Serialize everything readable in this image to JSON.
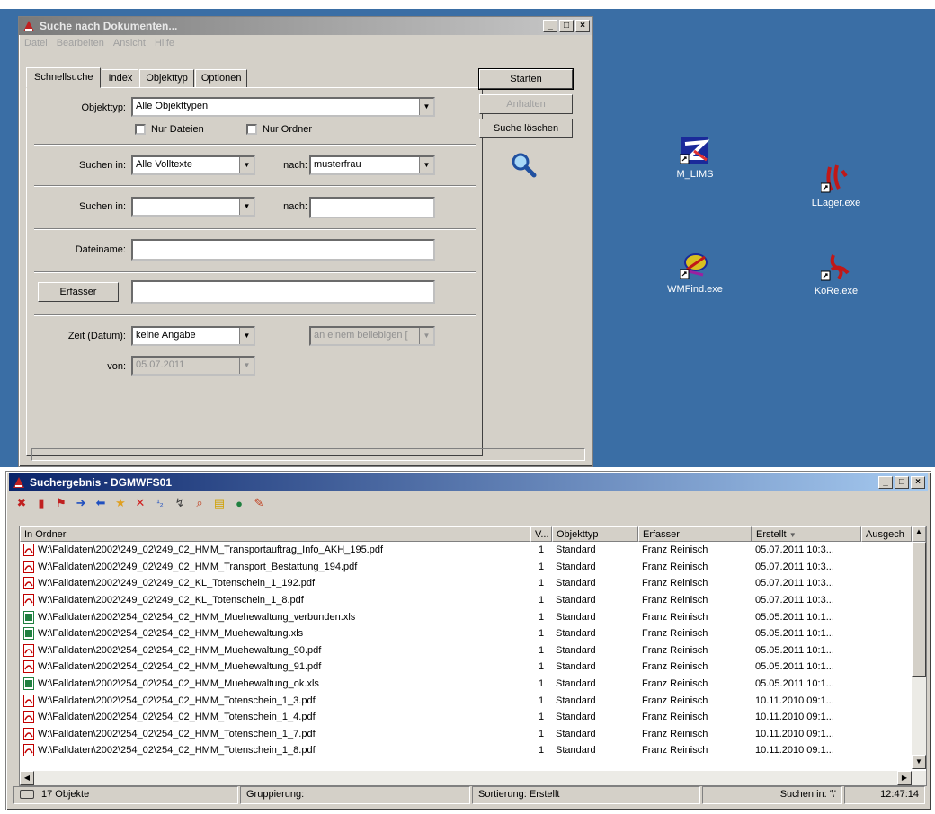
{
  "search_window": {
    "title": "Suche nach Dokumenten...",
    "menu": [
      "Datei",
      "Bearbeiten",
      "Ansicht",
      "Hilfe"
    ],
    "tabs": [
      "Schnellsuche",
      "Index",
      "Objekttyp",
      "Optionen"
    ],
    "objekttyp_label": "Objekttyp:",
    "objekttyp_value": "Alle Objekttypen",
    "nur_dateien": "Nur Dateien",
    "nur_ordner": "Nur Ordner",
    "suchen_in_label": "Suchen in:",
    "suchen_in_1_value": "Alle Volltexte",
    "nach_label": "nach:",
    "nach_1_value": "musterfrau",
    "suchen_in_2_value": "",
    "nach_2_value": "",
    "dateiname_label": "Dateiname:",
    "dateiname_value": "",
    "erfasser_button": "Erfasser",
    "erfasser_value": "",
    "zeit_label": "Zeit (Datum):",
    "zeit_value": "keine Angabe",
    "zeit_mode_value": "an einem beliebigen [",
    "von_label": "von:",
    "von_value": "05.07.2011",
    "start_button": "Starten",
    "anhalten_button": "Anhalten",
    "suche_loeschen_button": "Suche löschen"
  },
  "desktop_icons": [
    {
      "label": "M_LIMS",
      "color": "#1a2a9a"
    },
    {
      "label": "LLager.exe",
      "color": "#c01818"
    },
    {
      "label": "WMFind.exe",
      "color": "#d8c020"
    },
    {
      "label": "KoRe.exe",
      "color": "#c01818"
    }
  ],
  "result_window": {
    "title": "Suchergebnis - DGMWFS01",
    "columns": [
      "In Ordner",
      "V...",
      "Objekttyp",
      "Erfasser",
      "Erstellt",
      "Ausgech"
    ],
    "rows": [
      {
        "folder": "W:\\Falldaten\\2002\\249_02\\249_02_HMM_Transportauftrag_Info_AKH_195.pdf",
        "v": "1",
        "type": "Standard",
        "erfasser": "Franz Reinisch",
        "erstellt": "05.07.2011 10:3...",
        "icon": "pdf"
      },
      {
        "folder": "W:\\Falldaten\\2002\\249_02\\249_02_HMM_Transport_Bestattung_194.pdf",
        "v": "1",
        "type": "Standard",
        "erfasser": "Franz Reinisch",
        "erstellt": "05.07.2011 10:3...",
        "icon": "pdf"
      },
      {
        "folder": "W:\\Falldaten\\2002\\249_02\\249_02_KL_Totenschein_1_192.pdf",
        "v": "1",
        "type": "Standard",
        "erfasser": "Franz Reinisch",
        "erstellt": "05.07.2011 10:3...",
        "icon": "pdf"
      },
      {
        "folder": "W:\\Falldaten\\2002\\249_02\\249_02_KL_Totenschein_1_8.pdf",
        "v": "1",
        "type": "Standard",
        "erfasser": "Franz Reinisch",
        "erstellt": "05.07.2011 10:3...",
        "icon": "pdf"
      },
      {
        "folder": "W:\\Falldaten\\2002\\254_02\\254_02_HMM_Muehewaltung_verbunden.xls",
        "v": "1",
        "type": "Standard",
        "erfasser": "Franz Reinisch",
        "erstellt": "05.05.2011 10:1...",
        "icon": "xls"
      },
      {
        "folder": "W:\\Falldaten\\2002\\254_02\\254_02_HMM_Muehewaltung.xls",
        "v": "1",
        "type": "Standard",
        "erfasser": "Franz Reinisch",
        "erstellt": "05.05.2011 10:1...",
        "icon": "xls"
      },
      {
        "folder": "W:\\Falldaten\\2002\\254_02\\254_02_HMM_Muehewaltung_90.pdf",
        "v": "1",
        "type": "Standard",
        "erfasser": "Franz Reinisch",
        "erstellt": "05.05.2011 10:1...",
        "icon": "pdf"
      },
      {
        "folder": "W:\\Falldaten\\2002\\254_02\\254_02_HMM_Muehewaltung_91.pdf",
        "v": "1",
        "type": "Standard",
        "erfasser": "Franz Reinisch",
        "erstellt": "05.05.2011 10:1...",
        "icon": "pdf"
      },
      {
        "folder": "W:\\Falldaten\\2002\\254_02\\254_02_HMM_Muehewaltung_ok.xls",
        "v": "1",
        "type": "Standard",
        "erfasser": "Franz Reinisch",
        "erstellt": "05.05.2011 10:1...",
        "icon": "xls"
      },
      {
        "folder": "W:\\Falldaten\\2002\\254_02\\254_02_HMM_Totenschein_1_3.pdf",
        "v": "1",
        "type": "Standard",
        "erfasser": "Franz Reinisch",
        "erstellt": "10.11.2010 09:1...",
        "icon": "pdf"
      },
      {
        "folder": "W:\\Falldaten\\2002\\254_02\\254_02_HMM_Totenschein_1_4.pdf",
        "v": "1",
        "type": "Standard",
        "erfasser": "Franz Reinisch",
        "erstellt": "10.11.2010 09:1...",
        "icon": "pdf"
      },
      {
        "folder": "W:\\Falldaten\\2002\\254_02\\254_02_HMM_Totenschein_1_7.pdf",
        "v": "1",
        "type": "Standard",
        "erfasser": "Franz Reinisch",
        "erstellt": "10.11.2010 09:1...",
        "icon": "pdf"
      },
      {
        "folder": "W:\\Falldaten\\2002\\254_02\\254_02_HMM_Totenschein_1_8.pdf",
        "v": "1",
        "type": "Standard",
        "erfasser": "Franz Reinisch",
        "erstellt": "10.11.2010 09:1...",
        "icon": "pdf"
      }
    ],
    "status": {
      "count": "17 Objekte",
      "gruppierung": "Gruppierung:",
      "sortierung": "Sortierung: Erstellt",
      "suchen_in": "Suchen in: '\\'",
      "time": "12:47:14"
    }
  },
  "colors": {
    "desktop": "#3a6ea5",
    "window": "#d4d0c8",
    "title_active": "#0a246a",
    "pdf": "#c00000",
    "xls": "#208040"
  }
}
